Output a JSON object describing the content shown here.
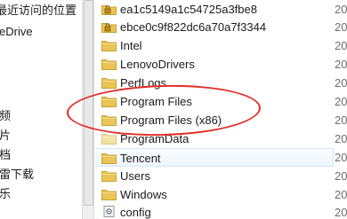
{
  "nav_pane": {
    "items": [
      {
        "label": "最近访问的位置"
      },
      {
        "label": "eDrive"
      },
      {
        "label": "频"
      },
      {
        "label": "片"
      },
      {
        "label": "档"
      },
      {
        "label": "雷下载"
      },
      {
        "label": "乐"
      }
    ]
  },
  "file_list": {
    "rows": [
      {
        "name": "ea1c5149a1c54725a3fbe8",
        "icon": "locked-folder-icon"
      },
      {
        "name": "ebce0c9f822dc6a70a7f3344",
        "icon": "locked-folder-icon"
      },
      {
        "name": "Intel",
        "icon": "folder-icon"
      },
      {
        "name": "LenovoDrivers",
        "icon": "folder-icon"
      },
      {
        "name": "PerfLogs",
        "icon": "folder-icon"
      },
      {
        "name": "Program Files",
        "icon": "folder-icon"
      },
      {
        "name": "Program Files (x86)",
        "icon": "folder-icon"
      },
      {
        "name": "ProgramData",
        "icon": "light-folder-icon"
      },
      {
        "name": "Tencent",
        "icon": "folder-icon"
      },
      {
        "name": "Users",
        "icon": "folder-icon"
      },
      {
        "name": "Windows",
        "icon": "folder-icon"
      },
      {
        "name": "config",
        "icon": "settings-file-icon"
      }
    ]
  },
  "date_column": {
    "cells": [
      "20",
      "20",
      "20",
      "20",
      "20",
      "20",
      "20",
      "20",
      "20",
      "20",
      "20",
      "20"
    ]
  },
  "colors": {
    "folder": "#e9c456",
    "annotation": "#e0302b",
    "selection": "#eef5fd"
  }
}
